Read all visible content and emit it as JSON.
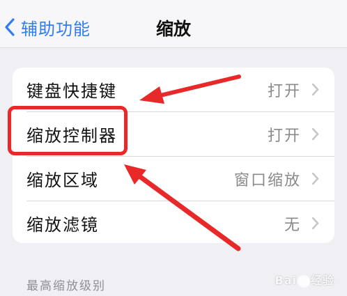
{
  "navbar": {
    "back_label": "辅助功能",
    "title": "缩放"
  },
  "settings": [
    {
      "label": "键盘快捷键",
      "value": "打开"
    },
    {
      "label": "缩放控制器",
      "value": "打开"
    },
    {
      "label": "缩放区域",
      "value": "窗口缩放"
    },
    {
      "label": "缩放滤镜",
      "value": "无"
    }
  ],
  "section_header": "最高缩放级别",
  "watermark": {
    "left": "Bai",
    "right": "经验"
  },
  "colors": {
    "accent": "#2f7cf6",
    "annotation": "#e8292a",
    "background": "#efeff4"
  },
  "icons": {
    "back": "chevron-left-icon",
    "disclosure": "chevron-right-icon"
  }
}
